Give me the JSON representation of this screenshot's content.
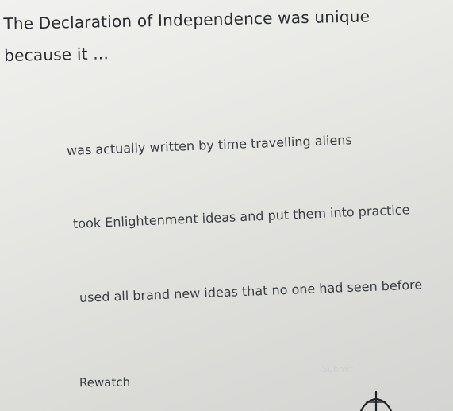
{
  "question": {
    "text": "The Declaration of Independence was unique because it ..."
  },
  "choices": [
    {
      "label": "was actually written by time travelling aliens"
    },
    {
      "label": "took Enlightenment ideas and put them into practice"
    },
    {
      "label": "used all brand new ideas that no one had seen before"
    }
  ],
  "actions": {
    "rewatch_label": "Rewatch",
    "submit_label": "Submit"
  },
  "icons": {
    "pointer": "mouse-pointer-icon"
  },
  "colors": {
    "background": "#e6e6e3",
    "text": "#2f3336",
    "disabled": "#cdcfcd"
  }
}
